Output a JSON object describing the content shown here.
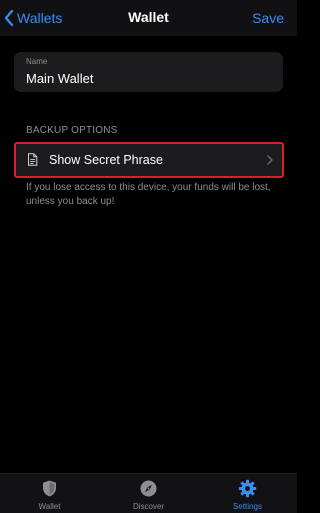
{
  "nav": {
    "back_label": "Wallets",
    "title": "Wallet",
    "save_label": "Save"
  },
  "name_field": {
    "label": "Name",
    "value": "Main Wallet"
  },
  "backup": {
    "section_header": "BACKUP OPTIONS",
    "show_secret_label": "Show Secret Phrase",
    "help_text": "If you lose access to this device, your funds will be lost, unless you back up!"
  },
  "tabs": [
    {
      "label": "Wallet",
      "icon": "shield-icon",
      "active": false
    },
    {
      "label": "Discover",
      "icon": "compass-icon",
      "active": false
    },
    {
      "label": "Settings",
      "icon": "gear-icon",
      "active": true
    }
  ],
  "colors": {
    "accent": "#3a8ef0",
    "highlight_border": "#d9202a",
    "background": "#000000",
    "cell": "#1c1c1e",
    "secondary_text": "#8e8e93",
    "inactive_tab": "#8e8e93"
  }
}
